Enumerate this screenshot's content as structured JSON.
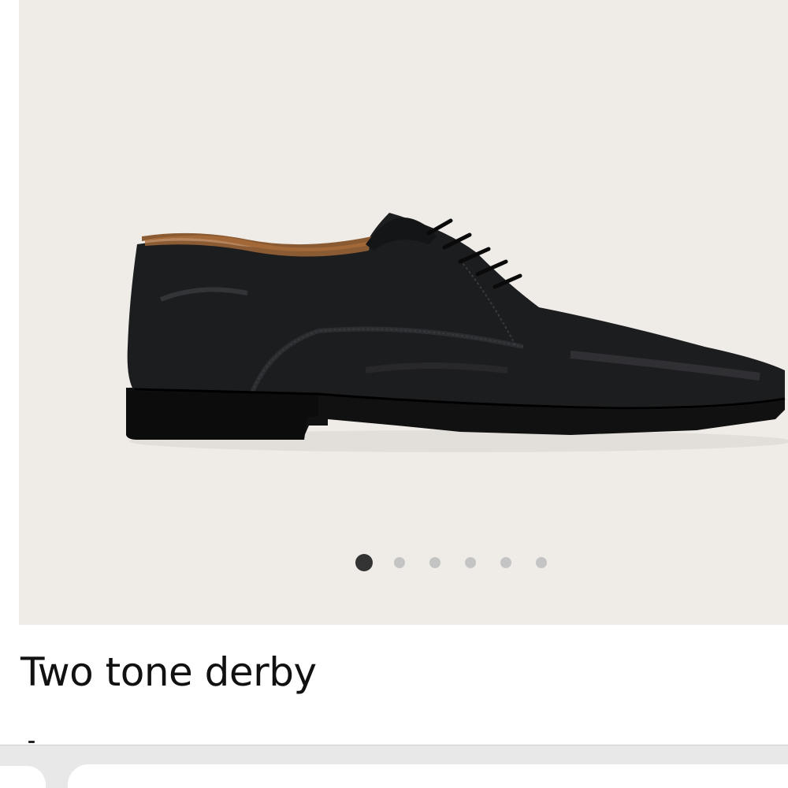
{
  "product": {
    "title": "Two tone derby",
    "image_icon": "black-leather-derby-shoe"
  },
  "carousel": {
    "total_slides": 6,
    "active_index": 0
  },
  "colors": {
    "gallery_background": "#efece8",
    "dot_active": "#333333",
    "dot_inactive": "#c4c4c4"
  }
}
